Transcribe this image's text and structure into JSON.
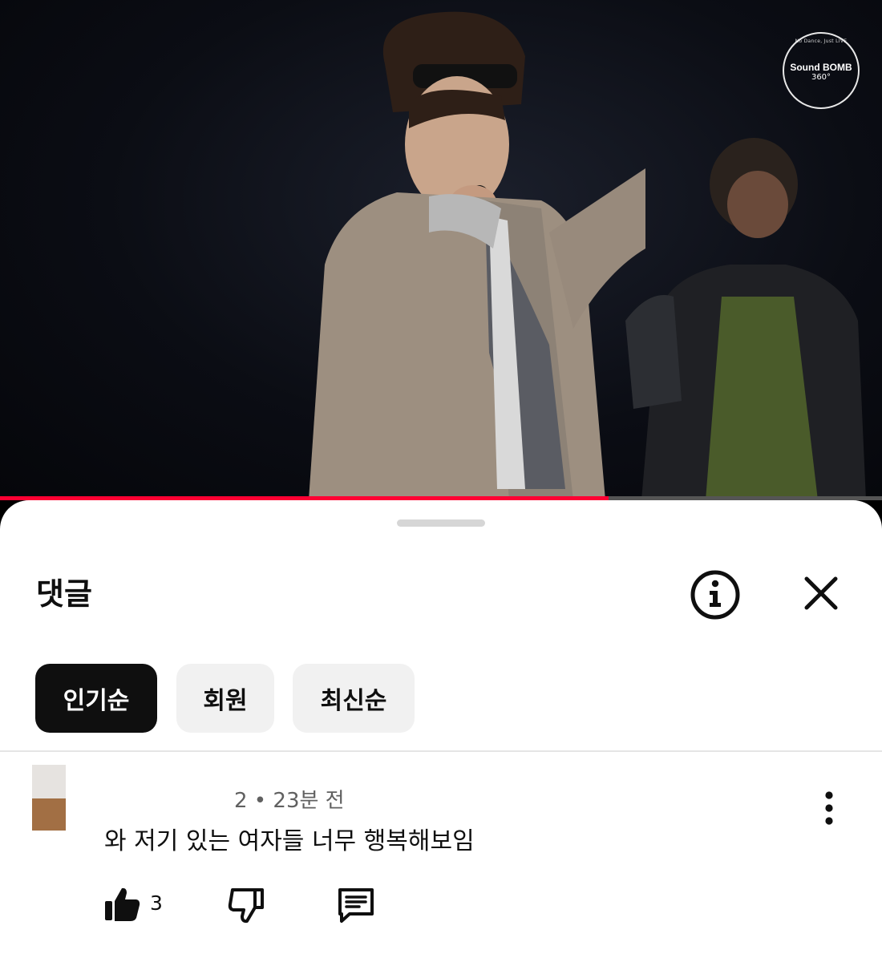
{
  "video": {
    "watermark": {
      "top_text": "No Dance, Just LIVE",
      "title": "Sound BOMB",
      "subtitle": "360°"
    },
    "progress_percent": 69
  },
  "comments_sheet": {
    "title": "댓글",
    "info_icon": "info-circle-icon",
    "close_icon": "close-icon",
    "sort_chips": [
      {
        "label": "인기순",
        "selected": true
      },
      {
        "label": "회원",
        "selected": false
      },
      {
        "label": "최신순",
        "selected": false
      }
    ],
    "comments": [
      {
        "meta": "2 • 23분 전",
        "text": "와 저기 있는 여자들 너무 행복해보임",
        "likes": "3",
        "like_icon": "thumb-up-filled-icon",
        "dislike_icon": "thumb-down-icon",
        "reply_icon": "reply-icon",
        "more_icon": "more-vertical-icon"
      }
    ]
  },
  "colors": {
    "progress": "#ff0033",
    "chip_active": "#0f0f0f",
    "chip_inactive": "#f1f1f1"
  }
}
